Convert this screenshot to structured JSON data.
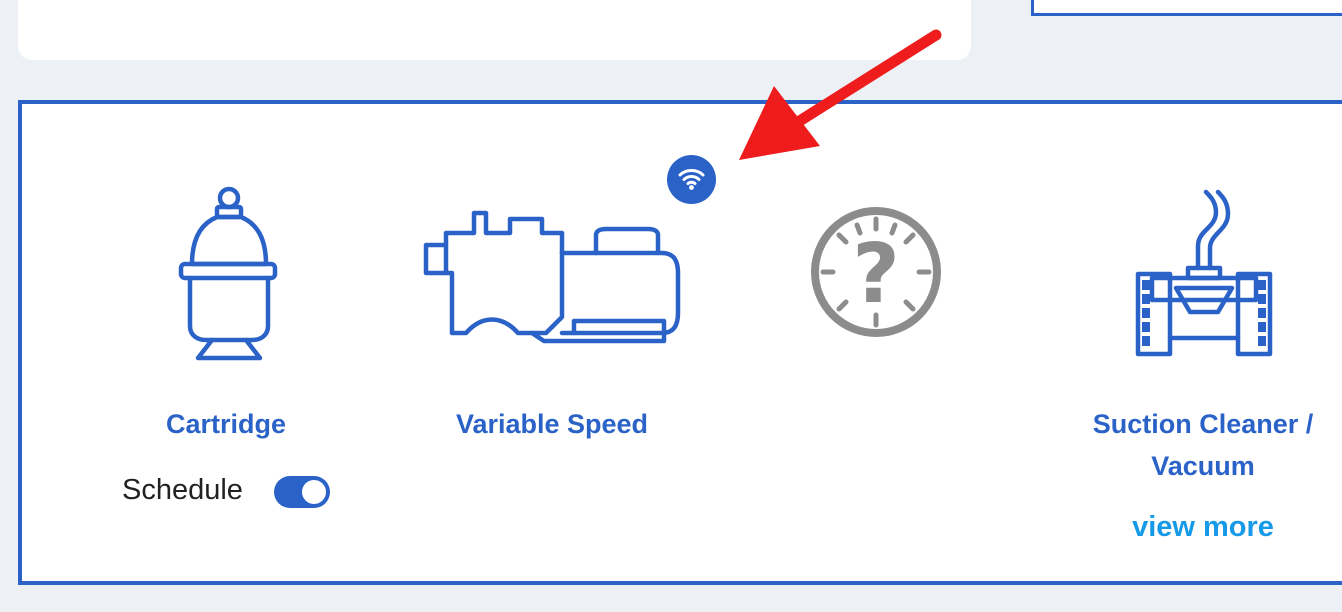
{
  "equipment": {
    "items": [
      {
        "label": "Cartridge",
        "icon": "cartridge-filter-icon"
      },
      {
        "label": "Variable Speed",
        "icon": "variable-speed-pump-icon"
      },
      {
        "label": "",
        "icon": "unknown-device-icon"
      },
      {
        "label": "Suction Cleaner / Vacuum",
        "icon": "suction-cleaner-icon"
      }
    ],
    "schedule": {
      "label": "Schedule",
      "enabled": true
    },
    "view_more": "view more",
    "wifi_badge_icon": "wifi-icon"
  },
  "annotation": {
    "icon": "red-arrow-icon",
    "color": "#ee1c1c"
  },
  "colors": {
    "accent": "#2a62c8",
    "link": "#169ae8",
    "unknown_icon": "#8c8c8c",
    "background": "#edf1f6"
  }
}
